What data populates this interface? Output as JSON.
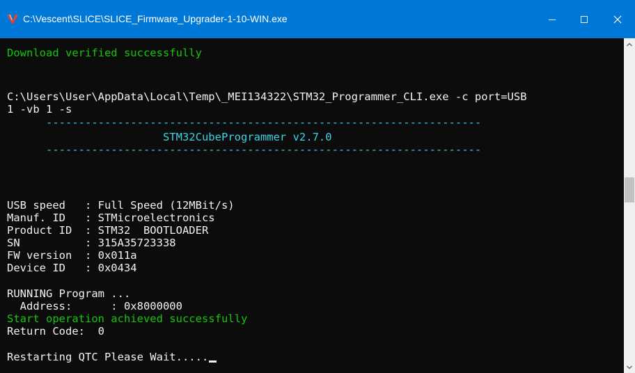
{
  "window": {
    "title": "C:\\Vescent\\SLICE\\SLICE_Firmware_Upgrader-1-10-WIN.exe",
    "icon": "red-v-app-icon",
    "accent_color": "#0078d7"
  },
  "console": {
    "lines": [
      {
        "text": "Download verified successfully",
        "color": "green"
      },
      {
        "text": "C:\\Users\\User\\AppData\\Local\\Temp\\_MEI134322\\STM32_Programmer_CLI.exe -c port=USB",
        "color": "white"
      },
      {
        "text": "1 -vb 1 -s",
        "color": "white"
      },
      {
        "text": "      -------------------------------------------------------------------",
        "color": "cyan"
      },
      {
        "text": "                        STM32CubeProgrammer v2.7.0",
        "color": "cyan"
      },
      {
        "text": "      -------------------------------------------------------------------",
        "color": "cyan"
      },
      {
        "text": "USB speed   : Full Speed (12MBit/s)",
        "color": "white"
      },
      {
        "text": "Manuf. ID   : STMicroelectronics",
        "color": "white"
      },
      {
        "text": "Product ID  : STM32  BOOTLOADER",
        "color": "white"
      },
      {
        "text": "SN          : 315A35723338",
        "color": "white"
      },
      {
        "text": "FW version  : 0x011a",
        "color": "white"
      },
      {
        "text": "Device ID   : 0x0434",
        "color": "white"
      },
      {
        "text": "RUNNING Program ...",
        "color": "white"
      },
      {
        "text": "  Address:      : 0x8000000",
        "color": "white"
      },
      {
        "text": "Start operation achieved successfully",
        "color": "green"
      },
      {
        "text": "Return Code:  0",
        "color": "white"
      },
      {
        "text": "Restarting QTC Please Wait.....",
        "color": "white"
      }
    ]
  }
}
